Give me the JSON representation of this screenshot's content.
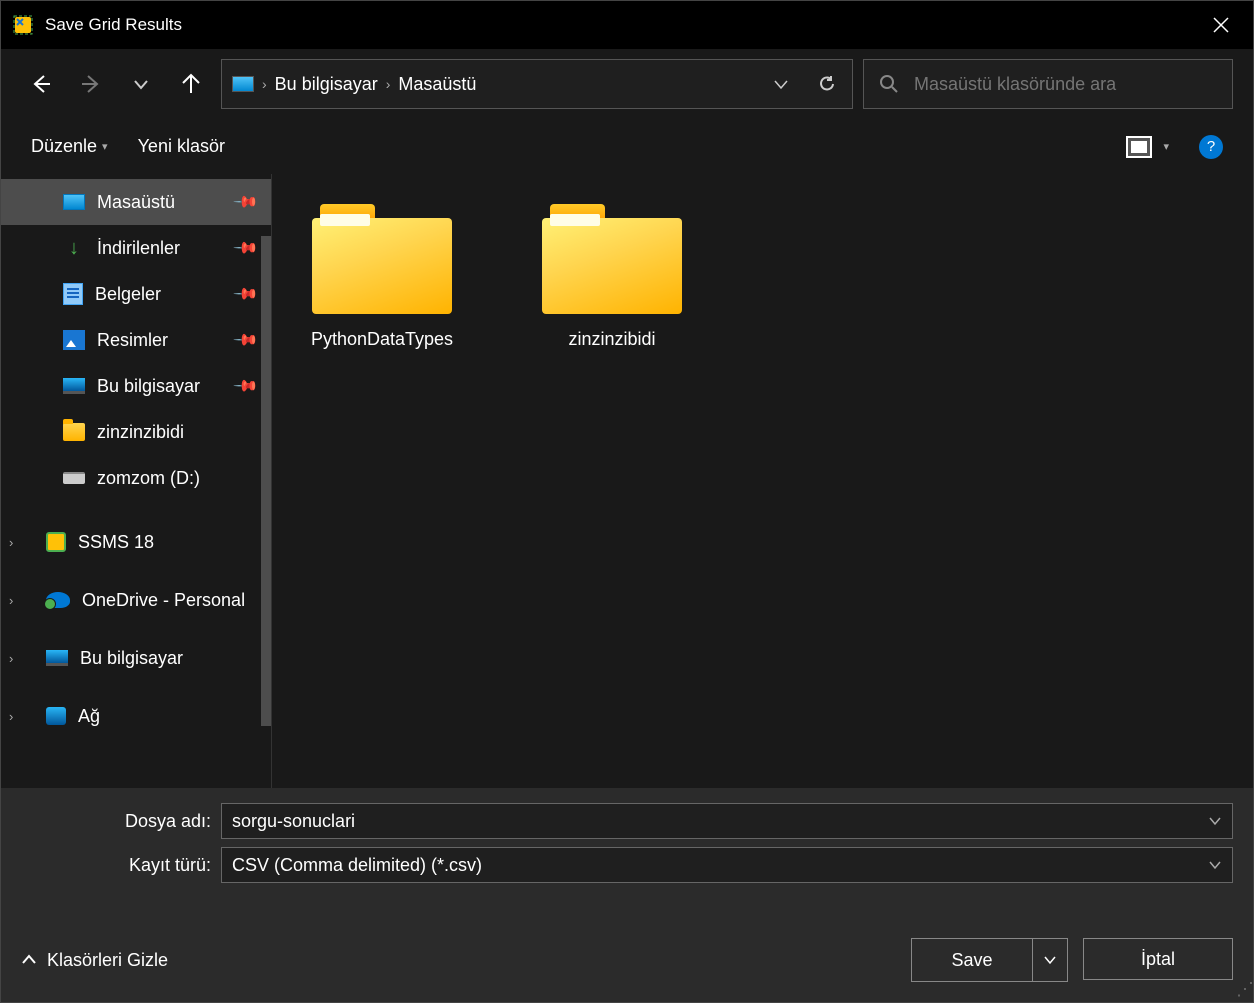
{
  "title": "Save Grid Results",
  "breadcrumb": {
    "pc": "Bu bilgisayar",
    "loc": "Masaüstü"
  },
  "search": {
    "placeholder": "Masaüstü klasöründe ara"
  },
  "toolbar": {
    "organize": "Düzenle",
    "newfolder": "Yeni klasör"
  },
  "sidebar": {
    "quick": [
      {
        "label": "Masaüstü",
        "icon": "desktop",
        "pin": true,
        "selected": true
      },
      {
        "label": "İndirilenler",
        "icon": "download",
        "pin": true
      },
      {
        "label": "Belgeler",
        "icon": "docs",
        "pin": true
      },
      {
        "label": "Resimler",
        "icon": "pics",
        "pin": true
      },
      {
        "label": "Bu bilgisayar",
        "icon": "pc",
        "pin": true
      },
      {
        "label": "zinzinzibidi",
        "icon": "folder"
      },
      {
        "label": "zomzom (D:)",
        "icon": "drive"
      }
    ],
    "roots": [
      {
        "label": "SSMS 18",
        "icon": "ssms",
        "exp": true
      },
      {
        "label": "OneDrive - Personal",
        "icon": "onedrive",
        "exp": true
      },
      {
        "label": "Bu bilgisayar",
        "icon": "pc",
        "exp": true
      },
      {
        "label": "Ağ",
        "icon": "net",
        "exp": true
      }
    ]
  },
  "folders": [
    {
      "name": "PythonDataTypes"
    },
    {
      "name": "zinzinzibidi"
    }
  ],
  "form": {
    "filename_label": "Dosya adı:",
    "filename_value": "sorgu-sonuclari",
    "filetype_label": "Kayıt türü:",
    "filetype_value": "CSV (Comma delimited) (*.csv)"
  },
  "footer": {
    "hide_folders": "Klasörleri Gizle",
    "save": "Save",
    "cancel": "İptal"
  }
}
